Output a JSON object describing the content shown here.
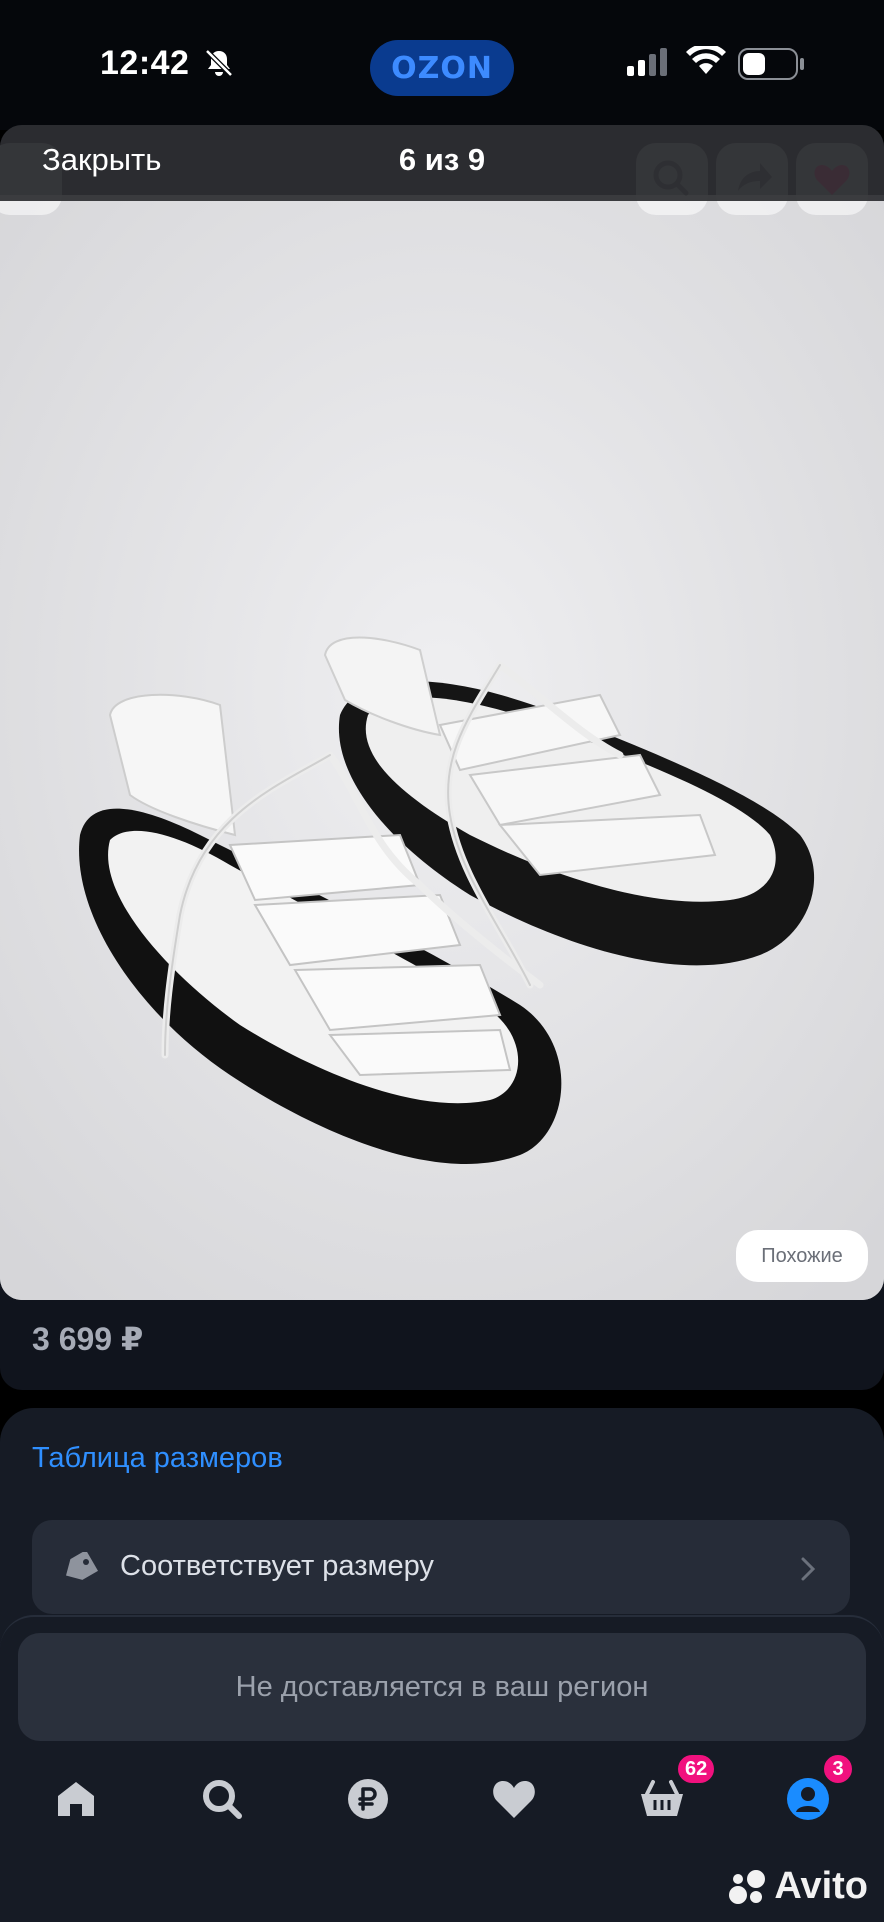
{
  "status_bar": {
    "time": "12:42",
    "center_badge": "OZON",
    "icons": [
      "bell-slash-icon",
      "signal-icon",
      "wifi-icon",
      "battery-icon"
    ]
  },
  "viewer": {
    "close_label": "Закрыть",
    "counter": "6 из 9",
    "bg_icons": [
      "back-icon",
      "search-icon",
      "share-icon",
      "heart-icon"
    ],
    "similar_label": "Похожие",
    "image_alt": "white sandals"
  },
  "product": {
    "price": "3 699 ₽"
  },
  "size": {
    "table_link": "Таблица размеров",
    "fit_label": "Соответствует размеру",
    "icons": [
      "tag-icon",
      "chevron-right-icon"
    ]
  },
  "notice": "Не доставляется в ваш регион",
  "nav": {
    "items": [
      {
        "name": "home",
        "icon": "home-icon"
      },
      {
        "name": "search",
        "icon": "search-icon"
      },
      {
        "name": "payments",
        "icon": "ruble-icon"
      },
      {
        "name": "favorites",
        "icon": "heart-icon"
      },
      {
        "name": "cart",
        "icon": "basket-icon",
        "badge": "62"
      },
      {
        "name": "profile",
        "icon": "profile-icon",
        "badge": "3"
      }
    ]
  },
  "watermark": "Avito",
  "colors": {
    "accent": "#2f8fff",
    "badge": "#f1117e",
    "active": "#1a8cff"
  }
}
